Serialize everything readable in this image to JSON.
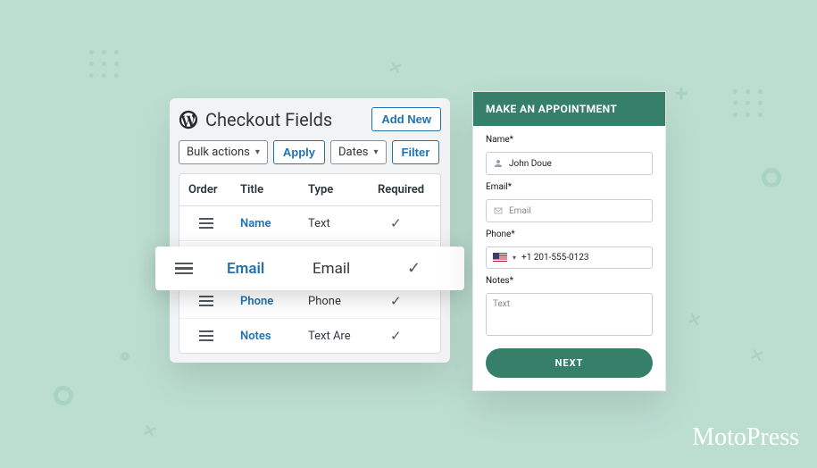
{
  "admin": {
    "title": "Checkout Fields",
    "add_new": "Add New",
    "bulk_label": "Bulk actions",
    "apply": "Apply",
    "dates": "Dates",
    "filter": "Filter",
    "columns": {
      "order": "Order",
      "title": "Title",
      "type": "Type",
      "required": "Required"
    },
    "rows": [
      {
        "title": "Name",
        "type": "Text"
      },
      {
        "title": "Phone",
        "type": "Phone"
      },
      {
        "title": "Notes",
        "type": "Text Are"
      }
    ]
  },
  "floating": {
    "title": "Email",
    "type": "Email"
  },
  "widget": {
    "heading": "MAKE AN APPOINTMENT",
    "name_label": "Name*",
    "name_value": "John Doue",
    "email_label": "Email*",
    "email_placeholder": "Email",
    "phone_label": "Phone*",
    "phone_value": "+1 201-555-0123",
    "notes_label": "Notes*",
    "notes_placeholder": "Text",
    "next": "NEXT"
  },
  "brand": "MotoPress"
}
